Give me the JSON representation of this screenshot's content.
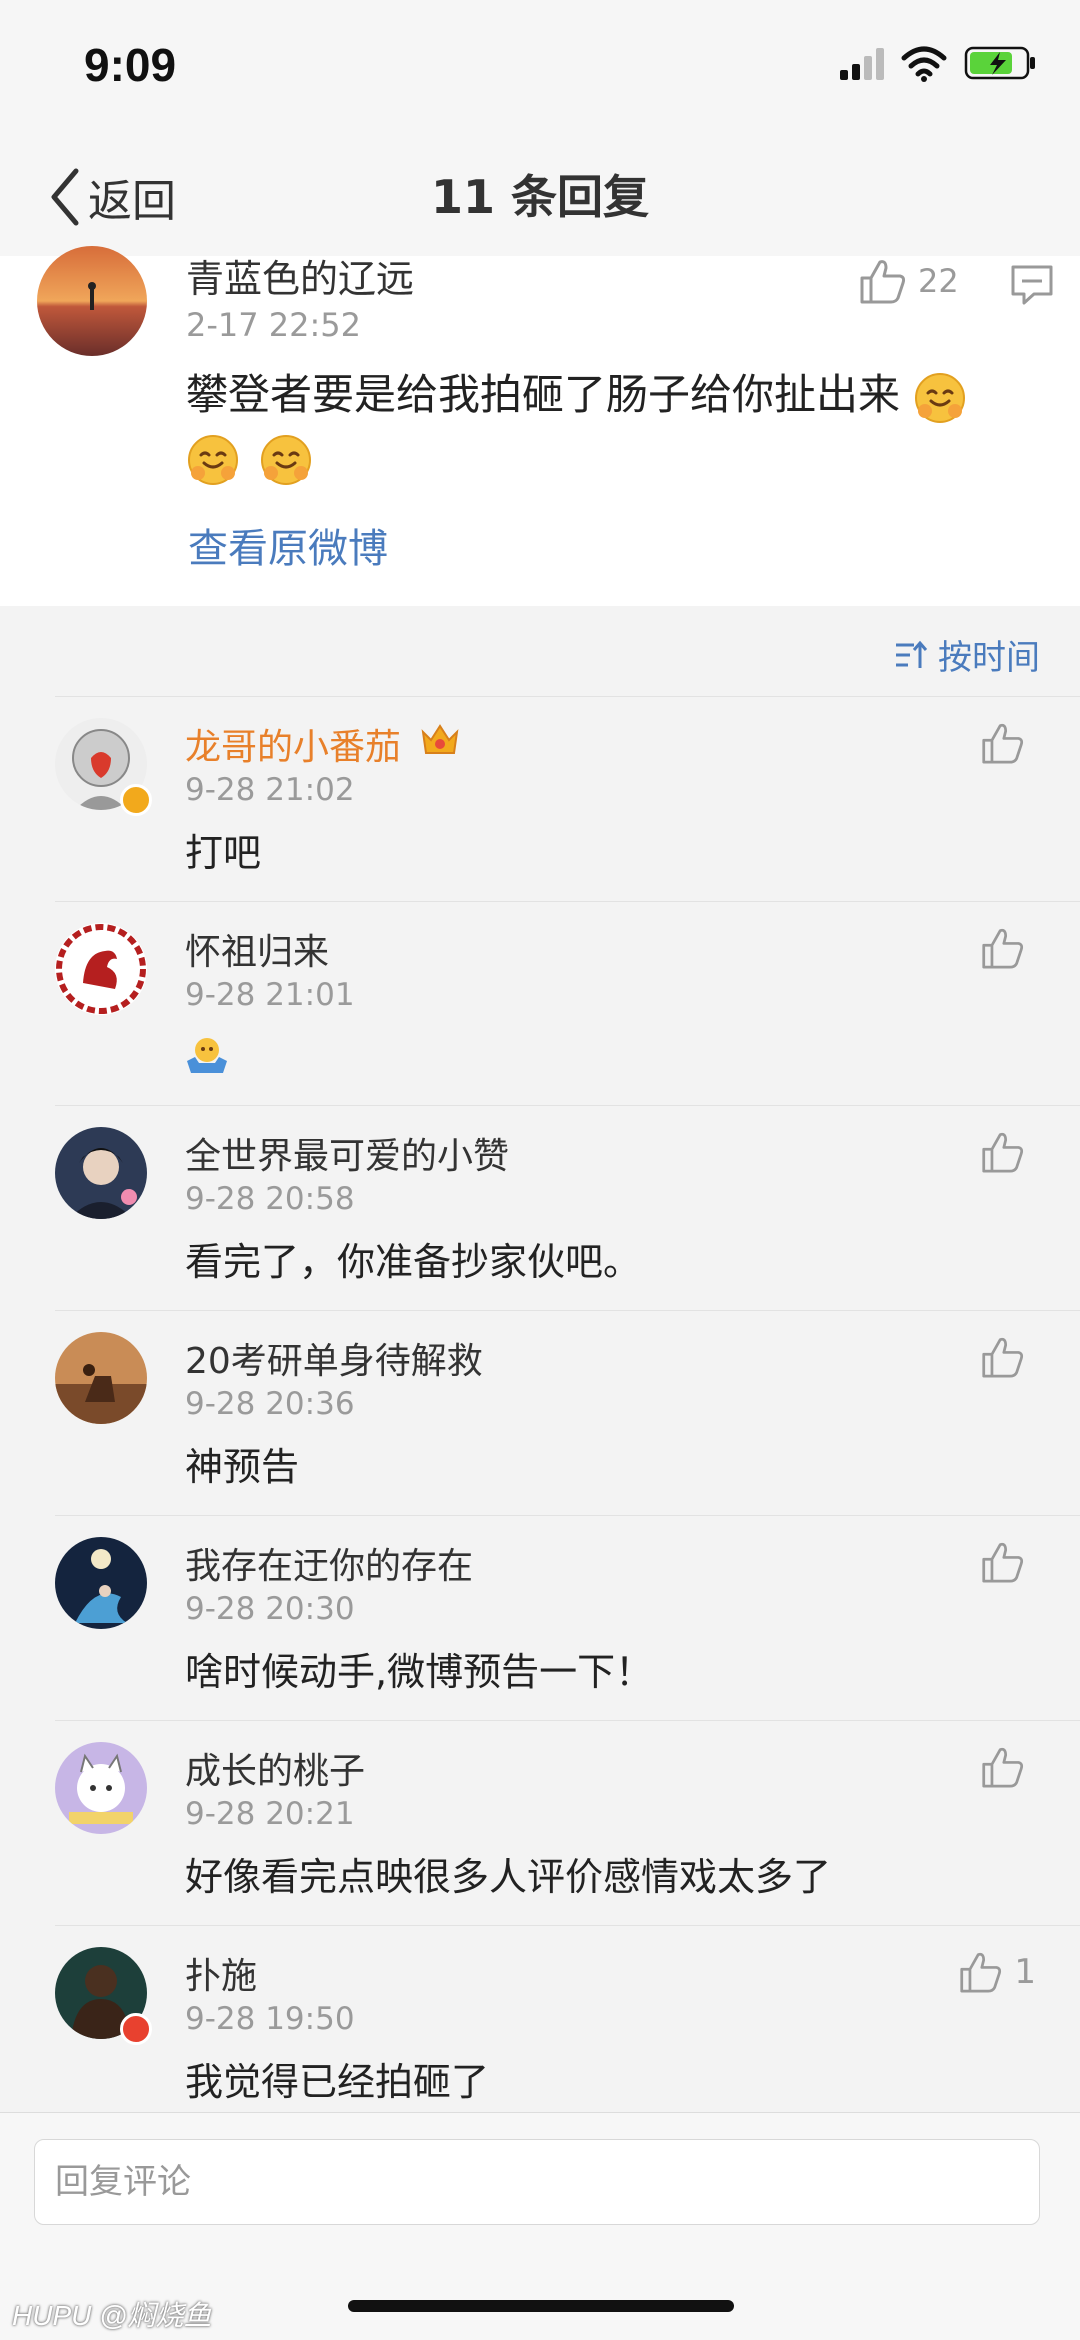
{
  "status": {
    "time": "9:09"
  },
  "nav": {
    "back_label": "返回",
    "title": "11 条回复"
  },
  "original": {
    "username": "青蓝色的辽远",
    "date": "2-17 22:52",
    "likes": "22",
    "content": "攀登者要是给我拍砸了肠子给你扯出来",
    "emojis": [
      "hug-emoji",
      "hug-emoji",
      "hug-emoji"
    ],
    "view_original": "查看原微博"
  },
  "sort": {
    "label": "按时间"
  },
  "replies": [
    {
      "username": "龙哥的小番茄",
      "date": "9-28 21:02",
      "text": "打吧",
      "likes": "",
      "vip": true
    },
    {
      "username": "怀祖归来",
      "date": "9-28 21:01",
      "text": "",
      "likes": ""
    },
    {
      "username": "全世界最可爱的小赞",
      "date": "9-28 20:58",
      "text": "看完了，你准备抄家伙吧。",
      "likes": ""
    },
    {
      "username": "20考研单身待解救",
      "date": "9-28 20:36",
      "text": "神预告",
      "likes": ""
    },
    {
      "username": "我存在迂你的存在",
      "date": "9-28 20:30",
      "text": "啥时候动手,微博预告一下！",
      "likes": ""
    },
    {
      "username": "成长的桃子",
      "date": "9-28 20:21",
      "text": "好像看完点映很多人评价感情戏太多了",
      "likes": ""
    },
    {
      "username": "扑施",
      "date": "9-28 19:50",
      "text": "我觉得已经拍砸了",
      "likes": "1"
    }
  ],
  "input": {
    "placeholder": "回复评论"
  },
  "watermark": {
    "brand": "HUPU",
    "handle": "@焖烧鱼"
  },
  "colors": {
    "link": "#4a7bbd",
    "vip_name": "#e8802a",
    "battery": "#5ad33a"
  }
}
